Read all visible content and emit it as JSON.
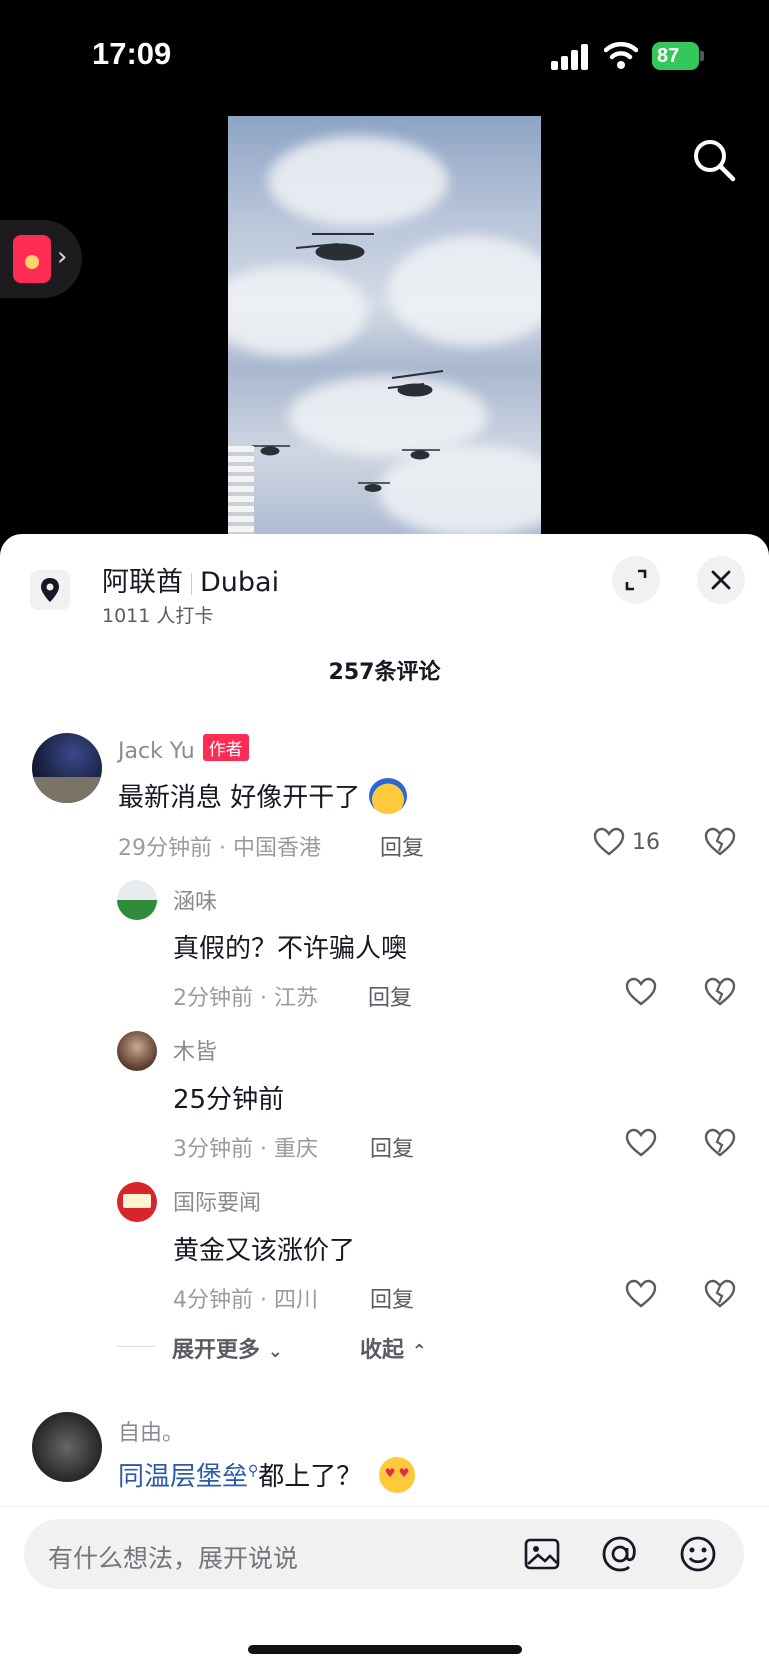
{
  "status_bar": {
    "time": "17:09",
    "battery": "87"
  },
  "location": {
    "title": "阿联酋",
    "title_en": "Dubai",
    "checkins": "1011 人打卡"
  },
  "comments_header": {
    "count_label": "257条评论"
  },
  "comments": [
    {
      "name": "Jack Yu",
      "badge": "作者",
      "text": "最新消息 好像开干了",
      "meta": "29分钟前 · 中国香港",
      "reply_label": "回复",
      "likes": "16"
    }
  ],
  "replies": [
    {
      "name": "涵味",
      "text": "真假的？不许骗人噢",
      "meta": "2分钟前 · 江苏",
      "reply_label": "回复"
    },
    {
      "name": "木皆",
      "text": "25分钟前",
      "meta": "3分钟前 · 重庆",
      "reply_label": "回复"
    },
    {
      "name": "国际要闻",
      "text": "黄金又该涨价了",
      "meta": "4分钟前 · 四川",
      "reply_label": "回复"
    }
  ],
  "thread_controls": {
    "expand_more": "展开更多",
    "collapse": "收起"
  },
  "next_comment": {
    "name": "自由。",
    "link_text": "同温层堡垒",
    "text": "都上了？"
  },
  "input": {
    "placeholder": "有什么想法，展开说说"
  },
  "colors": {
    "accent": "#fe2c55",
    "battery": "#34c759",
    "link": "#2b5aa8"
  }
}
